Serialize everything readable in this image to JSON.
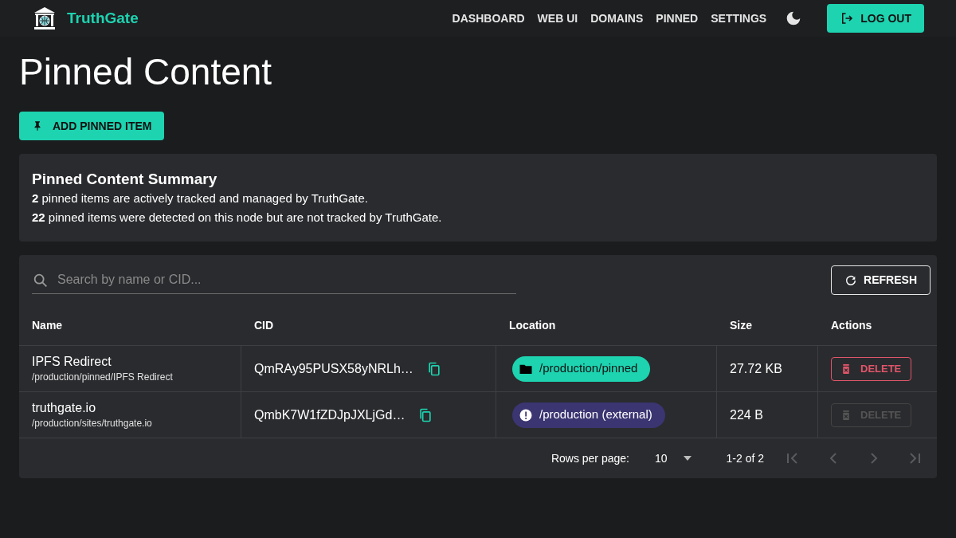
{
  "brand": "TruthGate",
  "nav": [
    {
      "label": "DASHBOARD",
      "selected": false
    },
    {
      "label": "WEB UI",
      "selected": false
    },
    {
      "label": "DOMAINS",
      "selected": false
    },
    {
      "label": "PINNED",
      "selected": false
    },
    {
      "label": "SETTINGS",
      "selected": false
    }
  ],
  "logout": "LOG OUT",
  "page_title": "Pinned Content",
  "add_button": "ADD PINNED ITEM",
  "summary": {
    "title": "Pinned Content Summary",
    "lines": [
      "**2** pinned items are actively tracked and managed by TruthGate.",
      "**22** pinned items were detected on this node but are not tracked by TruthGate."
    ]
  },
  "search": {
    "placeholder": "Search by name or CID..."
  },
  "refresh": "REFRESH",
  "table": {
    "columns": [
      "Name",
      "CID",
      "Location",
      "Size",
      "Actions"
    ],
    "rows": [
      {
        "name": "IPFS Redirect",
        "path": "/production/pinned/IPFS Redirect",
        "cid": "QmRAy95PUSX58yNRLh…",
        "location": {
          "kind": "pinned",
          "label": "/production/pinned"
        },
        "size": "27.72 KB",
        "delete": {
          "label": "DELETE",
          "disabled": false
        }
      },
      {
        "name": "truthgate.io",
        "path": "/production/sites/truthgate.io",
        "cid": "QmbK7W1fZDJpJXLjGd…",
        "location": {
          "kind": "external",
          "label": "/production (external)"
        },
        "size": "224 B",
        "delete": {
          "label": "DELETE",
          "disabled": true
        }
      }
    ]
  },
  "pagination": {
    "rows_per_page_label": "Rows per page:",
    "rows_per_page": "10",
    "range": "1-2 of 2",
    "buttons": [
      {
        "kind": "first",
        "disabled": true
      },
      {
        "kind": "prev",
        "disabled": true
      },
      {
        "kind": "next",
        "disabled": true
      },
      {
        "kind": "last",
        "disabled": true
      }
    ]
  }
}
